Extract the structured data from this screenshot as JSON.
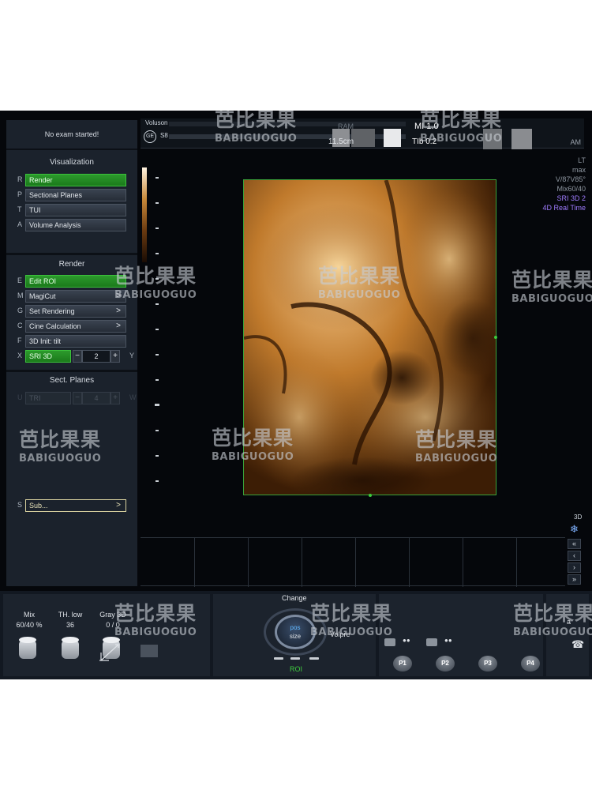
{
  "left_panel": {
    "exam_status": "No exam started!",
    "visualization": {
      "title": "Visualization",
      "items": [
        {
          "key": "R",
          "label": "Render"
        },
        {
          "key": "P",
          "label": "Sectional Planes"
        },
        {
          "key": "T",
          "label": "TUI"
        },
        {
          "key": "A",
          "label": "Volume Analysis"
        }
      ]
    },
    "render": {
      "title": "Render",
      "items": [
        {
          "key": "E",
          "label": "Edit ROI"
        },
        {
          "key": "M",
          "label": "MagiCut",
          "arrow": ">"
        },
        {
          "key": "G",
          "label": "Set Rendering",
          "arrow": ">"
        },
        {
          "key": "C",
          "label": "Cine Calculation",
          "arrow": ">"
        },
        {
          "key": "F",
          "label": "3D Init: tilt"
        }
      ],
      "stepper": {
        "key": "X",
        "label": "SRI 3D",
        "minus": "−",
        "value": "2",
        "plus": "+",
        "right_key": "Y"
      }
    },
    "sect_planes": {
      "title": "Sect. Planes",
      "stepper": {
        "key": "U",
        "label": "TRI",
        "minus": "−",
        "value": "4",
        "plus": "+",
        "right_key": "W"
      }
    },
    "sub": {
      "key": "S",
      "label": "Sub...",
      "arrow": ">"
    }
  },
  "header": {
    "probe_name": "Voluson",
    "logo": "GE",
    "probe_model": "S8",
    "ram_label": "RAM",
    "depth": "11.5cm",
    "mi": "MI 1.0",
    "tib": "TIb 0.2",
    "right_label": "AM"
  },
  "right_status": [
    {
      "text": "LT",
      "color": "grey"
    },
    {
      "text": "max",
      "color": "grey"
    },
    {
      "text": "V/87V85°",
      "color": "grey"
    },
    {
      "text": "Mix60/40",
      "color": "grey"
    },
    {
      "text": "SRI 3D 2",
      "color": "purple"
    },
    {
      "text": "4D Real Time",
      "color": "purple"
    }
  ],
  "side_controls": {
    "label_3d": "3D",
    "snow_icon": "❄",
    "buttons": [
      "«",
      "‹",
      "›",
      "»"
    ]
  },
  "console": {
    "mix": {
      "label": "Mix",
      "value": "60/40 %"
    },
    "th_low": {
      "label": "TH. low",
      "value": "36"
    },
    "gray3d": {
      "label": "Gray 3D",
      "value": "0 / 0"
    },
    "change": "Change",
    "pos": "pos",
    "size": "size",
    "volpre": "Volpre",
    "roi": "ROI",
    "presets": [
      "P1",
      "P2",
      "P3",
      "P4"
    ],
    "indicator_a": "a",
    "gear_icon": "☎"
  },
  "watermark": {
    "cn": "芭比果果",
    "en": "BABIGUOGUO"
  },
  "colors": {
    "active_green": "#2c9a2c",
    "status_purple": "#9f7cff",
    "roi_green": "#3aa33a"
  }
}
